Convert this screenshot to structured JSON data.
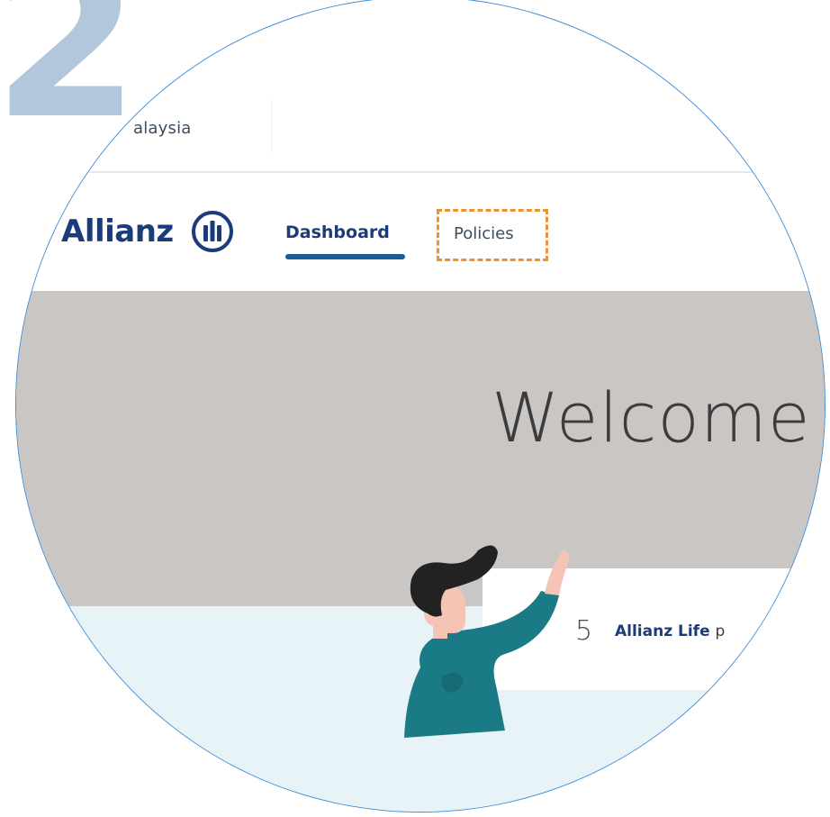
{
  "step": {
    "number": "2"
  },
  "topbar": {
    "country": "alaysia"
  },
  "navbar": {
    "brand": "Allianz",
    "logo_icon": "allianz-eagle-icon",
    "tabs": [
      {
        "label": "Dashboard",
        "active": true
      },
      {
        "label": "Policies",
        "highlighted": true
      }
    ]
  },
  "hero": {
    "title": "Welcome"
  },
  "summary_card": {
    "count": "5",
    "label": "Allianz Life",
    "label_rest": "p"
  },
  "illustration": {
    "icon": "waving-person-icon"
  },
  "colors": {
    "brand_blue": "#1c3b7a",
    "underline_blue": "#1e5a93",
    "highlight_orange": "#f0922b",
    "lens_border": "#3e8ed8",
    "step_number": "#b3c7dc",
    "hero_gray": "#c9c6c4",
    "lower_bg": "#e7f3f6",
    "person_teal": "#1a7a86"
  }
}
